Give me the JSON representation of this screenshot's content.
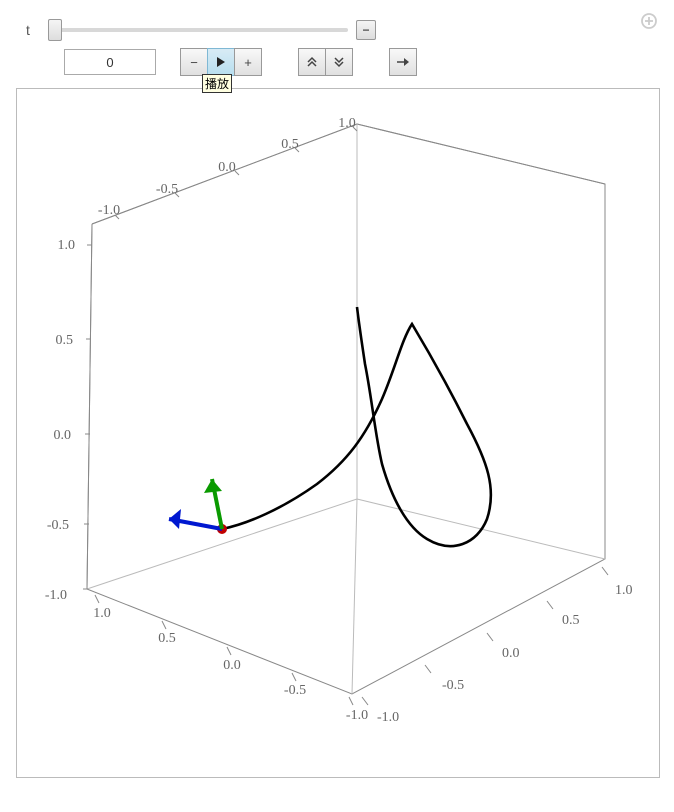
{
  "controls": {
    "param_label": "t",
    "value": "0",
    "collapse_label": "−",
    "buttons": {
      "dec": "−",
      "play": "▶",
      "inc": "+",
      "fast_up": "︽",
      "fast_down": "︾",
      "forward": "→"
    },
    "tooltip": "播放"
  },
  "plot3d": {
    "x_ticks": [
      "-1.0",
      "-0.5",
      "0.0",
      "0.5",
      "1.0"
    ],
    "y_ticks": [
      "-1.0",
      "-0.5",
      "0.0",
      "0.5",
      "1.0"
    ],
    "z_ticks": [
      "-1.0",
      "-0.5",
      "0.0",
      "0.5",
      "1.0"
    ],
    "x_range": [
      -1.0,
      1.0
    ],
    "y_range": [
      -1.0,
      1.0
    ],
    "z_range": [
      -1.0,
      1.0
    ]
  },
  "chart_data": {
    "type": "line",
    "title": "",
    "description": "3D parametric curve with point and Frenet-like arrows at t=0",
    "axes": {
      "x": [
        -1,
        1
      ],
      "y": [
        -1,
        1
      ],
      "z": [
        -1,
        1
      ]
    },
    "series": [
      {
        "name": "curve",
        "t_range": [
          0,
          6.28
        ],
        "points_xyz": [
          [
            -0.9,
            -0.45,
            -0.55
          ],
          [
            -0.75,
            -0.35,
            -0.52
          ],
          [
            -0.55,
            -0.2,
            -0.45
          ],
          [
            -0.35,
            -0.05,
            -0.35
          ],
          [
            -0.1,
            0.12,
            -0.15
          ],
          [
            0.1,
            0.3,
            0.1
          ],
          [
            0.25,
            0.45,
            0.35
          ],
          [
            0.35,
            0.55,
            0.55
          ],
          [
            0.45,
            0.55,
            0.35
          ],
          [
            0.55,
            0.45,
            0.0
          ],
          [
            0.6,
            0.35,
            -0.35
          ],
          [
            0.55,
            0.2,
            -0.5
          ],
          [
            0.4,
            0.1,
            -0.4
          ],
          [
            0.25,
            0.1,
            -0.15
          ],
          [
            0.15,
            0.2,
            0.15
          ],
          [
            0.1,
            0.35,
            0.4
          ]
        ]
      }
    ],
    "marker": {
      "xyz": [
        -0.9,
        -0.45,
        -0.55
      ],
      "color": "#cc0000"
    },
    "arrows": [
      {
        "name": "tangent",
        "from": [
          -0.9,
          -0.45,
          -0.55
        ],
        "to": [
          -0.55,
          -0.15,
          -0.45
        ],
        "color": "#008000"
      },
      {
        "name": "normal",
        "from": [
          -0.9,
          -0.45,
          -0.55
        ],
        "to": [
          -1.0,
          -0.9,
          -0.45
        ],
        "color": "#0000dd"
      }
    ]
  }
}
